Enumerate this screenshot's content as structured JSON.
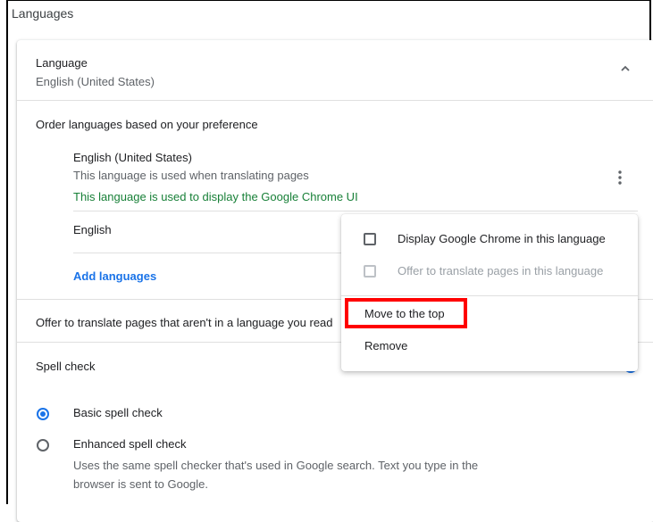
{
  "section": {
    "title": "Languages"
  },
  "language_card": {
    "header_title": "Language",
    "header_subtitle": "English (United States)",
    "order_label": "Order languages based on your preference",
    "languages": [
      {
        "name": "English (United States)",
        "line2": "This language is used when translating pages",
        "line3": "This language is used to display the Google Chrome UI"
      },
      {
        "name": "English"
      }
    ],
    "add_languages": "Add languages",
    "offer_translate": "Offer to translate pages that aren't in a language you read"
  },
  "spell_check": {
    "label": "Spell check",
    "basic": "Basic spell check",
    "enhanced": "Enhanced spell check",
    "enhanced_desc": "Uses the same spell checker that's used in Google search. Text you type in the browser is sent to Google."
  },
  "context_menu": {
    "display_in_lang": "Display Google Chrome in this language",
    "offer_translate": "Offer to translate pages in this language",
    "move_top": "Move to the top",
    "remove": "Remove"
  },
  "colors": {
    "accent": "#1a73e8",
    "green_text": "#188038",
    "highlight": "#ff0000"
  }
}
